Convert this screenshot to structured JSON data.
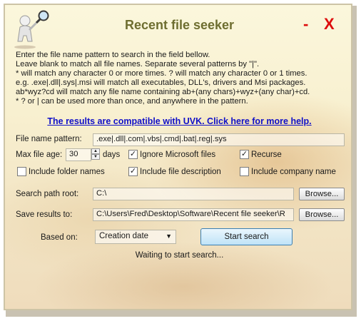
{
  "window": {
    "title": "Recent file seeker",
    "minimize_glyph": "-",
    "close_glyph": "X"
  },
  "intro_lines": [
    "Enter the file name pattern to search in the field bellow.",
    "Leave blank to match all file names. Separate several patterns by \"|\".",
    "* will match any character 0 or more times. ? will match any character 0 or 1 times.",
    "e.g. .exe|.dll|.sys|.msi will match all executables, DLL's, drivers and Msi packages.",
    "ab*wyz?cd will match any file name containing ab+(any chars)+wyz+(any char)+cd.",
    "* ? or | can be used more than once, and anywhere in the pattern."
  ],
  "link_text": "The results are compatible with UVK. Click here for more help.",
  "pattern": {
    "label": "File name pattern:",
    "value": ".exe|.dll|.com|.vbs|.cmd|.bat|.reg|.sys"
  },
  "max_age": {
    "label": "Max file age:",
    "value": "30",
    "unit": "days"
  },
  "checkboxes": {
    "ignore_ms": {
      "label": "Ignore Microsoft files",
      "checked": true
    },
    "recurse": {
      "label": "Recurse",
      "checked": true
    },
    "folder_names": {
      "label": "Include folder names",
      "checked": false
    },
    "file_desc": {
      "label": "Include file description",
      "checked": true
    },
    "company": {
      "label": "Include company name",
      "checked": false
    }
  },
  "search_root": {
    "label": "Search path root:",
    "value": "C:\\",
    "browse": "Browse..."
  },
  "save_results": {
    "label": "Save results to:",
    "value": "C:\\Users\\Fred\\Desktop\\Software\\Recent file seeker\\R",
    "browse": "Browse..."
  },
  "based_on": {
    "label": "Based on:",
    "value": "Creation date"
  },
  "start_label": "Start search",
  "status": "Waiting to start search...",
  "colors": {
    "title": "#6e6e30",
    "close": "#dd0d0d",
    "link": "#1010c8"
  },
  "icons": {
    "app": "magnifier-person-icon",
    "dropdown": "chevron-down-icon",
    "spin": "spin-arrows-icon"
  }
}
